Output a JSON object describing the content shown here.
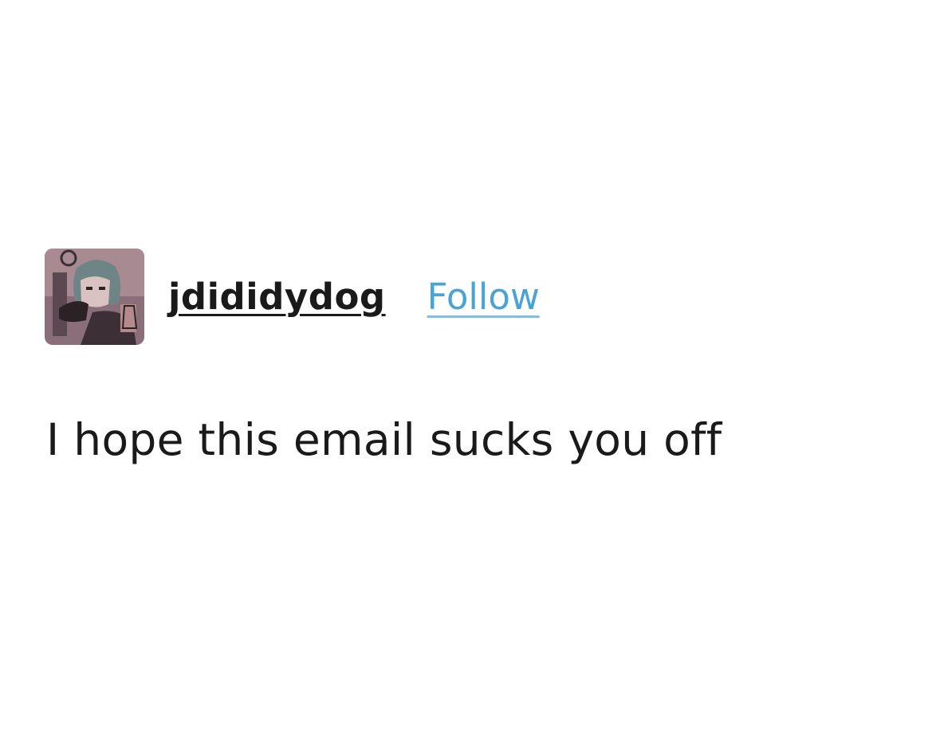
{
  "post": {
    "author": {
      "username": "jdididydog",
      "avatar_icon": "user-avatar"
    },
    "follow_label": "Follow",
    "body_text": "I hope this email sucks you off"
  },
  "colors": {
    "background": "#ffffff",
    "text": "#1a1a1a",
    "follow_link": "#4aa3d4"
  }
}
